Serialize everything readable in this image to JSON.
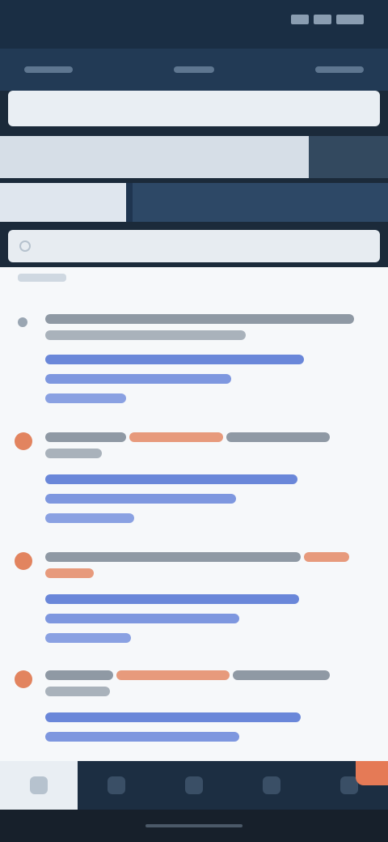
{
  "status_bar": {
    "time": "",
    "icons": [
      "signal-icon",
      "wifi-icon",
      "battery-icon"
    ]
  },
  "app_bar": {
    "tabs": [
      "",
      "",
      ""
    ]
  },
  "header": {
    "title": ""
  },
  "search": {
    "placeholder": "",
    "value": ""
  },
  "list": {
    "items": [
      {
        "accent": "#9aa6b2",
        "title": "",
        "snippet": ""
      },
      {
        "accent": "#e2845f",
        "title": "",
        "snippet": ""
      },
      {
        "accent": "#e2845f",
        "title": "",
        "snippet": ""
      },
      {
        "accent": "#e2845f",
        "title": "",
        "snippet": ""
      }
    ]
  },
  "bottom_nav": {
    "items": [
      "home-icon",
      "list-icon",
      "grid-icon",
      "bell-icon",
      "profile-icon"
    ],
    "active_index": 0
  },
  "colors": {
    "header_dark": "#1f3550",
    "panel_light": "#f6f8fa",
    "link_blue": "#6a87d9",
    "accent_orange": "#e57a56",
    "nav_dark": "#1c2e42"
  }
}
